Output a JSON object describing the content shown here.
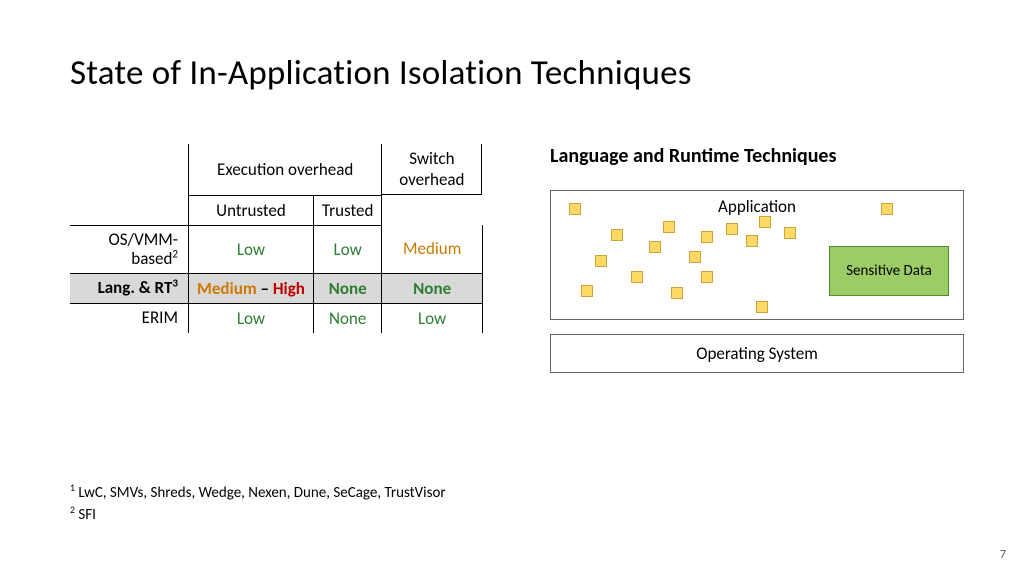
{
  "title": "State of In-Application Isolation Techniques",
  "table": {
    "head": {
      "exec_overhead": "Execution overhead",
      "switch_overhead": "Switch overhead",
      "untrusted": "Untrusted",
      "trusted": "Trusted"
    },
    "rows": {
      "osvmm": {
        "label": "OS/VMM-based",
        "sup": "2",
        "untrusted": "Low",
        "trusted": "Low",
        "switch": "Medium"
      },
      "langrt": {
        "label": "Lang. & RT",
        "sup": "3",
        "untrusted_a": "Medium",
        "untrusted_dash": " – ",
        "untrusted_b": "High",
        "trusted": "None",
        "switch": "None"
      },
      "erim": {
        "label": "ERIM",
        "untrusted": "Low",
        "trusted": "None",
        "switch": "Low"
      }
    }
  },
  "right": {
    "heading": "Language and Runtime Techniques",
    "app_label": "Application",
    "sensitive": "Sensitive Data",
    "os_label": "Operating System"
  },
  "footnotes": {
    "f1_sup": "1",
    "f1": " LwC, SMVs, Shreds, Wedge, Nexen, Dune, SeCage, TrustVisor",
    "f2_sup": "2",
    "f2": " SFI"
  },
  "page_number": "7"
}
